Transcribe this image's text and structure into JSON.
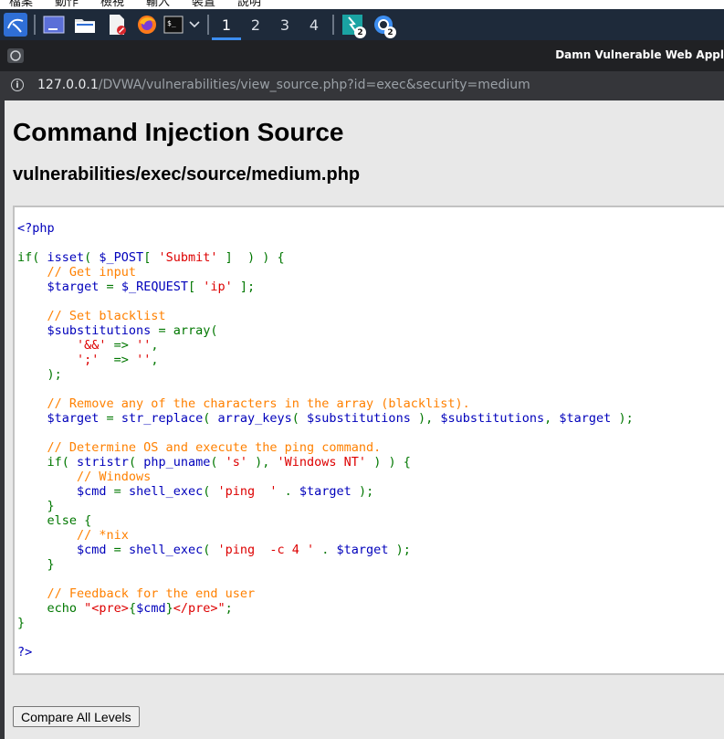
{
  "os_menu": [
    "檔案",
    "動作",
    "檢視",
    "輸入",
    "裝置",
    "說明"
  ],
  "taskbar": {
    "workspaces": [
      "1",
      "2",
      "3",
      "4"
    ],
    "active_workspace": "1",
    "badges": [
      "2",
      "2"
    ]
  },
  "browser": {
    "window_title": "Damn Vulnerable Web Appl",
    "url_host": "127.0.0.1",
    "url_path": "/DVWA/vulnerabilities/view_source.php?id=exec&security=medium"
  },
  "page": {
    "title": "Command Injection Source",
    "subtitle": "vulnerabilities/exec/source/medium.php",
    "compare_button": "Compare All Levels"
  },
  "code_lines": [
    [
      [
        "def",
        "<?php"
      ]
    ],
    [],
    [
      [
        "kw",
        "if( "
      ],
      [
        "def",
        "isset"
      ],
      [
        "kw",
        "( "
      ],
      [
        "def",
        "$_POST"
      ],
      [
        "kw",
        "[ "
      ],
      [
        "str",
        "'Submit'"
      ],
      [
        "kw",
        " ]  ) ) {"
      ]
    ],
    [
      [
        "kw",
        "    "
      ],
      [
        "com",
        "// Get input"
      ]
    ],
    [
      [
        "kw",
        "    "
      ],
      [
        "def",
        "$target "
      ],
      [
        "kw",
        "= "
      ],
      [
        "def",
        "$_REQUEST"
      ],
      [
        "kw",
        "[ "
      ],
      [
        "str",
        "'ip'"
      ],
      [
        "kw",
        " ];"
      ]
    ],
    [],
    [
      [
        "kw",
        "    "
      ],
      [
        "com",
        "// Set blacklist"
      ]
    ],
    [
      [
        "kw",
        "    "
      ],
      [
        "def",
        "$substitutions "
      ],
      [
        "kw",
        "= array("
      ]
    ],
    [
      [
        "kw",
        "        "
      ],
      [
        "str",
        "'&&' "
      ],
      [
        "kw",
        "=> "
      ],
      [
        "str",
        "''"
      ],
      [
        "kw",
        ","
      ]
    ],
    [
      [
        "kw",
        "        "
      ],
      [
        "str",
        "';'  "
      ],
      [
        "kw",
        "=> "
      ],
      [
        "str",
        "''"
      ],
      [
        "kw",
        ","
      ]
    ],
    [
      [
        "kw",
        "    );"
      ]
    ],
    [],
    [
      [
        "kw",
        "    "
      ],
      [
        "com",
        "// Remove any of the characters in the array (blacklist)."
      ]
    ],
    [
      [
        "kw",
        "    "
      ],
      [
        "def",
        "$target "
      ],
      [
        "kw",
        "= "
      ],
      [
        "def",
        "str_replace"
      ],
      [
        "kw",
        "( "
      ],
      [
        "def",
        "array_keys"
      ],
      [
        "kw",
        "( "
      ],
      [
        "def",
        "$substitutions "
      ],
      [
        "kw",
        "), "
      ],
      [
        "def",
        "$substitutions"
      ],
      [
        "kw",
        ", "
      ],
      [
        "def",
        "$target "
      ],
      [
        "kw",
        ");"
      ]
    ],
    [],
    [
      [
        "kw",
        "    "
      ],
      [
        "com",
        "// Determine OS and execute the ping command."
      ]
    ],
    [
      [
        "kw",
        "    if( "
      ],
      [
        "def",
        "stristr"
      ],
      [
        "kw",
        "( "
      ],
      [
        "def",
        "php_uname"
      ],
      [
        "kw",
        "( "
      ],
      [
        "str",
        "'s' "
      ],
      [
        "kw",
        "), "
      ],
      [
        "str",
        "'Windows NT' "
      ],
      [
        "kw",
        ") ) {"
      ]
    ],
    [
      [
        "kw",
        "        "
      ],
      [
        "com",
        "// Windows"
      ]
    ],
    [
      [
        "kw",
        "        "
      ],
      [
        "def",
        "$cmd "
      ],
      [
        "kw",
        "= "
      ],
      [
        "def",
        "shell_exec"
      ],
      [
        "kw",
        "( "
      ],
      [
        "str",
        "'ping  ' "
      ],
      [
        "kw",
        ". "
      ],
      [
        "def",
        "$target "
      ],
      [
        "kw",
        ");"
      ]
    ],
    [
      [
        "kw",
        "    }"
      ]
    ],
    [
      [
        "kw",
        "    else {"
      ]
    ],
    [
      [
        "kw",
        "        "
      ],
      [
        "com",
        "// *nix"
      ]
    ],
    [
      [
        "kw",
        "        "
      ],
      [
        "def",
        "$cmd "
      ],
      [
        "kw",
        "= "
      ],
      [
        "def",
        "shell_exec"
      ],
      [
        "kw",
        "( "
      ],
      [
        "str",
        "'ping  -c 4 ' "
      ],
      [
        "kw",
        ". "
      ],
      [
        "def",
        "$target "
      ],
      [
        "kw",
        ");"
      ]
    ],
    [
      [
        "kw",
        "    }"
      ]
    ],
    [],
    [
      [
        "kw",
        "    "
      ],
      [
        "com",
        "// Feedback for the end user"
      ]
    ],
    [
      [
        "kw",
        "    echo "
      ],
      [
        "str",
        "\"<pre>"
      ],
      [
        "kw",
        "{"
      ],
      [
        "def",
        "$cmd"
      ],
      [
        "kw",
        "}"
      ],
      [
        "str",
        "</pre>\""
      ],
      [
        "kw",
        ";"
      ]
    ],
    [
      [
        "kw",
        "}"
      ]
    ],
    [],
    [
      [
        "def",
        "?>"
      ]
    ]
  ],
  "colors": {
    "def": "#0000bb",
    "kw": "#007700",
    "str": "#dd0000",
    "com": "#ff8000"
  }
}
